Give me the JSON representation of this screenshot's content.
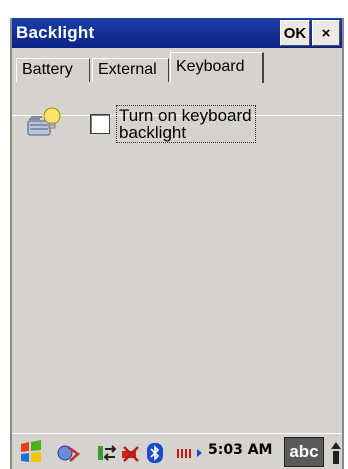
{
  "window": {
    "title": "Backlight",
    "ok_label": "OK",
    "close_label": "×"
  },
  "tabs": [
    {
      "label": "Battery",
      "active": false
    },
    {
      "label": "External",
      "active": false
    },
    {
      "label": "Keyboard",
      "active": true
    }
  ],
  "keyboard_tab": {
    "icon": "keyboard-backlight-icon",
    "checkbox_label": "Turn on keyboard backlight",
    "checked": false
  },
  "taskbar": {
    "time": "5:03 AM",
    "sip_label": "abc",
    "icons": [
      "windows-start-icon",
      "connectivity-icon",
      "sync-icon",
      "battery-low-icon",
      "bluetooth-icon",
      "signal-icon",
      "sip-keyboard-icon",
      "scroll-up-icon"
    ]
  },
  "colors": {
    "titlebar": "#0a2288",
    "background": "#d6d3ce",
    "title_text": "#ffffff"
  }
}
